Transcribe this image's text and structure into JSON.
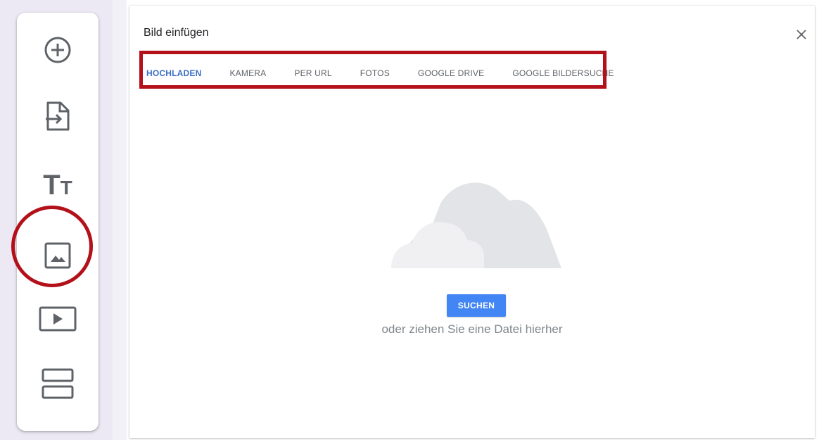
{
  "toolbar": {
    "items": [
      {
        "icon": "add-circle-icon",
        "label": "add-question"
      },
      {
        "icon": "import-icon",
        "label": "import-questions"
      },
      {
        "icon": "title-text-icon",
        "label": "add-title"
      },
      {
        "icon": "image-icon",
        "label": "add-image"
      },
      {
        "icon": "video-icon",
        "label": "add-video"
      },
      {
        "icon": "section-icon",
        "label": "add-section"
      }
    ]
  },
  "dialog": {
    "title": "Bild einfügen",
    "close_icon": "close-icon",
    "tabs": [
      {
        "label": "HOCHLADEN",
        "active": true
      },
      {
        "label": "KAMERA",
        "active": false
      },
      {
        "label": "PER URL",
        "active": false
      },
      {
        "label": "FOTOS",
        "active": false
      },
      {
        "label": "GOOGLE DRIVE",
        "active": false
      },
      {
        "label": "GOOGLE BILDERSUCHE",
        "active": false
      }
    ],
    "upload": {
      "button_label": "SUCHEN",
      "hint": "oder ziehen Sie eine Datei hierher"
    }
  },
  "colors": {
    "accent": "#4285f4",
    "active_tab": "#3c6fc5",
    "highlight": "#b3101a",
    "icon": "#5f6368"
  }
}
